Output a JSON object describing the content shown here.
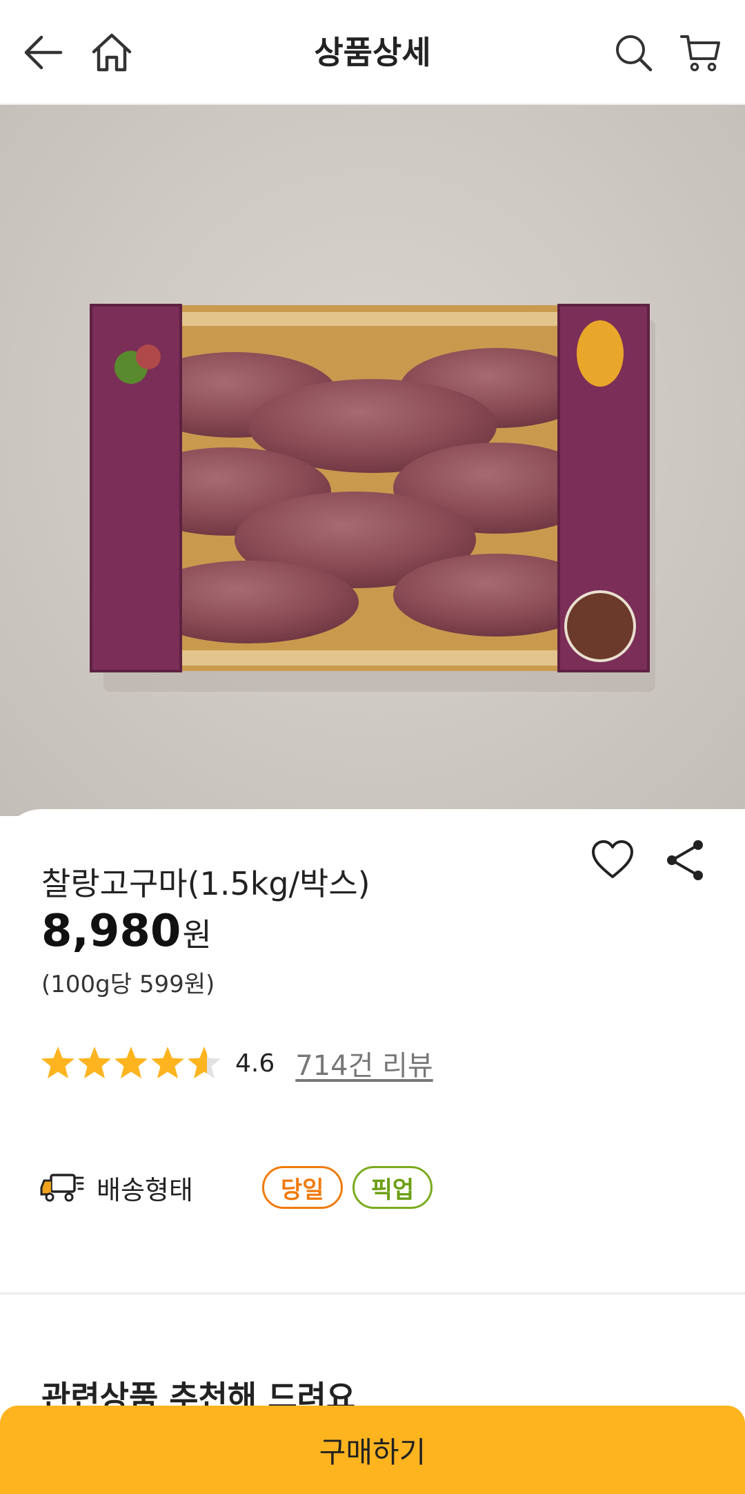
{
  "header": {
    "title": "상품상세",
    "back_icon": "back-arrow-icon",
    "home_icon": "home-icon",
    "search_icon": "search-icon",
    "cart_icon": "cart-icon"
  },
  "product": {
    "name": "찰랑고구마(1.5kg/박스)",
    "price": "8,980",
    "currency": "원",
    "unit_price": "(100g당 599원)",
    "image_icon": "sweet-potato-box-photo"
  },
  "rating": {
    "value": "4.6",
    "stars": 4.6,
    "reviews": "714건 리뷰",
    "star_color": "#FDB41F"
  },
  "delivery": {
    "label": "배송형태",
    "options": [
      "당일",
      "픽업"
    ]
  },
  "related": {
    "title": "관련상품 추천해 드려요"
  },
  "footer": {
    "buy_label": "구매하기",
    "accent": "#FDB41F"
  }
}
